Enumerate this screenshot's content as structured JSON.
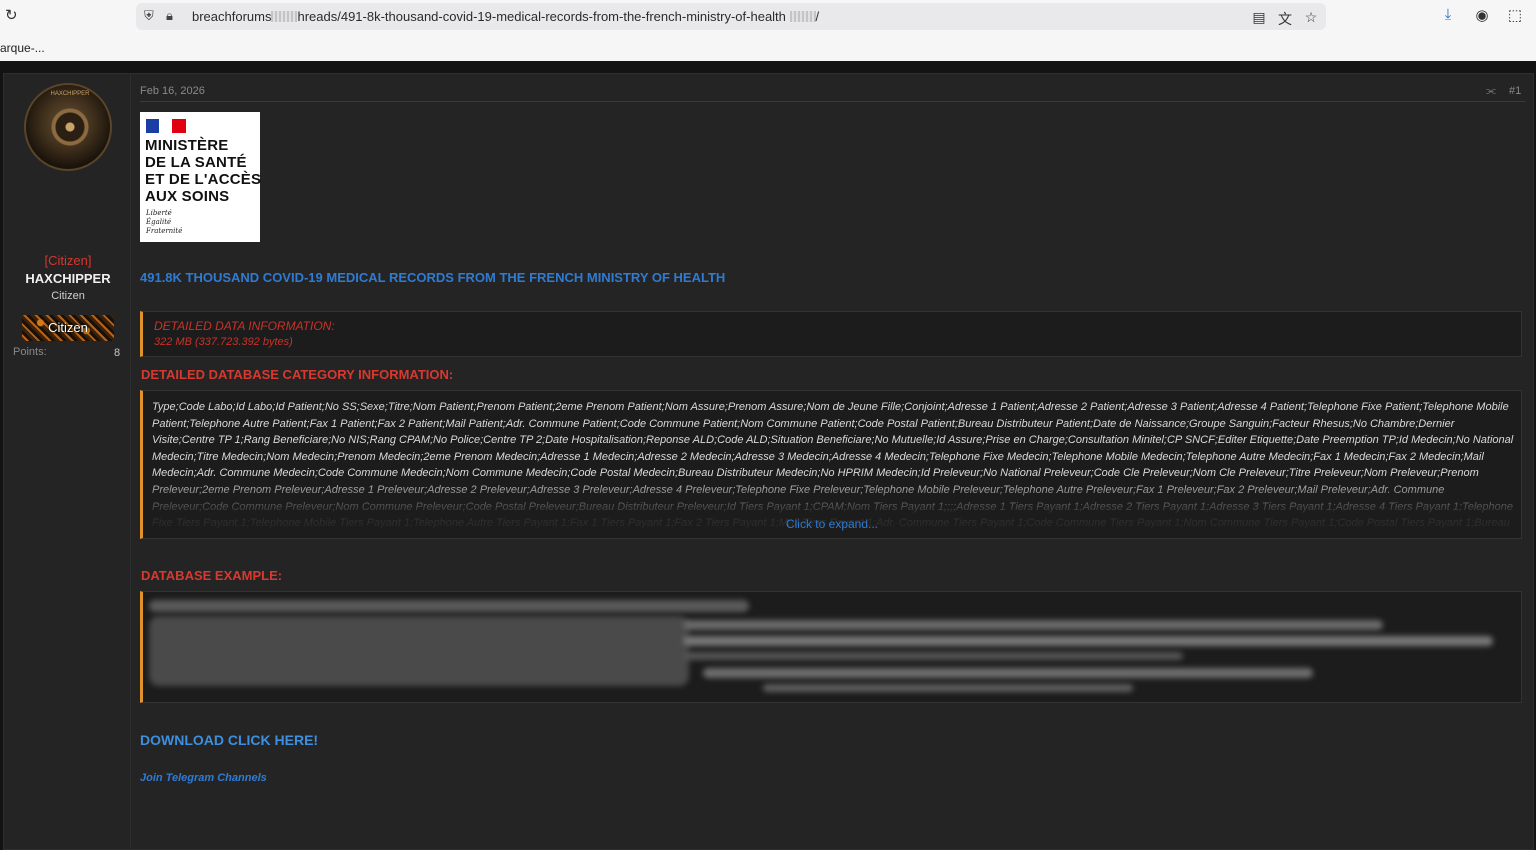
{
  "browser": {
    "url_prefix": "breachforums",
    "url_path": "hreads/491-8k-thousand-covid-19-medical-records-from-the-french-ministry-of-health",
    "url_suffix": "/",
    "tab_title": "arque-..."
  },
  "user": {
    "rank_label": "[Citizen]",
    "username": "HAXCHIPPER",
    "title": "Citizen",
    "badge": "Citizen",
    "points_label": "Points:",
    "points_value": "8",
    "avatar_text": "HAXCHIPPER"
  },
  "post": {
    "date": "Feb 16, 2026",
    "number": "#1",
    "logo_lines": [
      "MINISTÈRE",
      "DE LA SANTÉ",
      "ET DE L'ACCÈS",
      "AUX SOINS"
    ],
    "logo_motto": [
      "Liberté",
      "Égalité",
      "Fraternité"
    ],
    "title": "491.8K THOUSAND COVID-19 MEDICAL RECORDS FROM THE FRENCH MINISTRY OF HEALTH",
    "data_info_heading": "DETAILED DATA INFORMATION:",
    "data_info_size": "322 MB (337.723.392 bytes)",
    "category_heading": "DETAILED DATABASE CATEGORY INFORMATION:",
    "category_text": "Type;Code Labo;Id Labo;Id Patient;No SS;Sexe;Titre;Nom Patient;Prenom Patient;2eme Prenom Patient;Nom Assure;Prenom Assure;Nom de Jeune Fille;Conjoint;Adresse 1 Patient;Adresse 2 Patient;Adresse 3 Patient;Adresse 4 Patient;Telephone Fixe Patient;Telephone Mobile Patient;Telephone Autre Patient;Fax 1 Patient;Fax 2 Patient;Mail Patient;Adr. Commune Patient;Code Commune Patient;Nom Commune Patient;Code Postal Patient;Bureau Distributeur Patient;Date de Naissance;Groupe Sanguin;Facteur Rhesus;No Chambre;Dernier Visite;Centre TP 1;Rang Beneficiare;No NIS;Rang CPAM;No Police;Centre TP 2;Date Hospitalisation;Reponse ALD;Code ALD;Situation Beneficiare;No Mutuelle;Id Assure;Prise en Charge;Consultation Minitel;CP SNCF;Editer Etiquette;Date Preemption TP;Id Medecin;No National Medecin;Titre Medecin;Nom Medecin;Prenom Medecin;2eme Prenom Medecin;Adresse 1 Medecin;Adresse 2 Medecin;Adresse 3 Medecin;Adresse 4 Medecin;Telephone Fixe Medecin;Telephone Mobile Medecin;Telephone Autre Medecin;Fax 1 Medecin;Fax 2 Medecin;Mail Medecin;Adr. Commune Medecin;Code Commune Medecin;Nom Commune Medecin;Code Postal Medecin;Bureau Distributeur Medecin;No HPRIM Medecin;Id Preleveur;No National Preleveur;Code Cle Preleveur;Nom Cle Preleveur;Titre Preleveur;Nom Preleveur;Prenom Preleveur;2eme Prenom Preleveur;Adresse 1 Preleveur;Adresse 2 Preleveur;Adresse 3 Preleveur;Adresse 4 Preleveur;Telephone Fixe Preleveur;Telephone Mobile Preleveur;Telephone Autre Preleveur;Fax 1 Preleveur;Fax 2 Preleveur;Mail Preleveur;Adr. Commune Preleveur;Code Commune Preleveur;Nom Commune Preleveur;Code Postal Preleveur;Bureau Distributeur Preleveur;Id Tiers Payant 1;CPAM;Nom Tiers Payant 1;;;;Adresse 1 Tiers Payant 1;Adresse 2 Tiers Payant 1;Adresse 3 Tiers Payant 1;Adresse 4 Tiers Payant 1;Telephone Fixe Tiers Payant 1;Telephone Mobile Tiers Payant 1;Telephone Autre Tiers Payant 1;Fax 1 Tiers Payant 1;Fax 2 Tiers Payant 1;Mail Tiers Payant 1;Adr. Commune Tiers Payant 1;Code Commune Tiers Payant 1;Nom Commune Tiers Payant 1;Code Postal Tiers Payant 1;Bureau",
    "expand_label": "Click to expand...",
    "example_heading": "DATABASE EXAMPLE:",
    "download_label": "DOWNLOAD CLICK HERE!",
    "telegram_label": "Join Telegram Channels"
  },
  "colors": {
    "background": "#131313",
    "panel": "#242424",
    "accent_blue": "#2f7bd4",
    "accent_red": "#d8392f",
    "quote_border": "#e0932a"
  }
}
